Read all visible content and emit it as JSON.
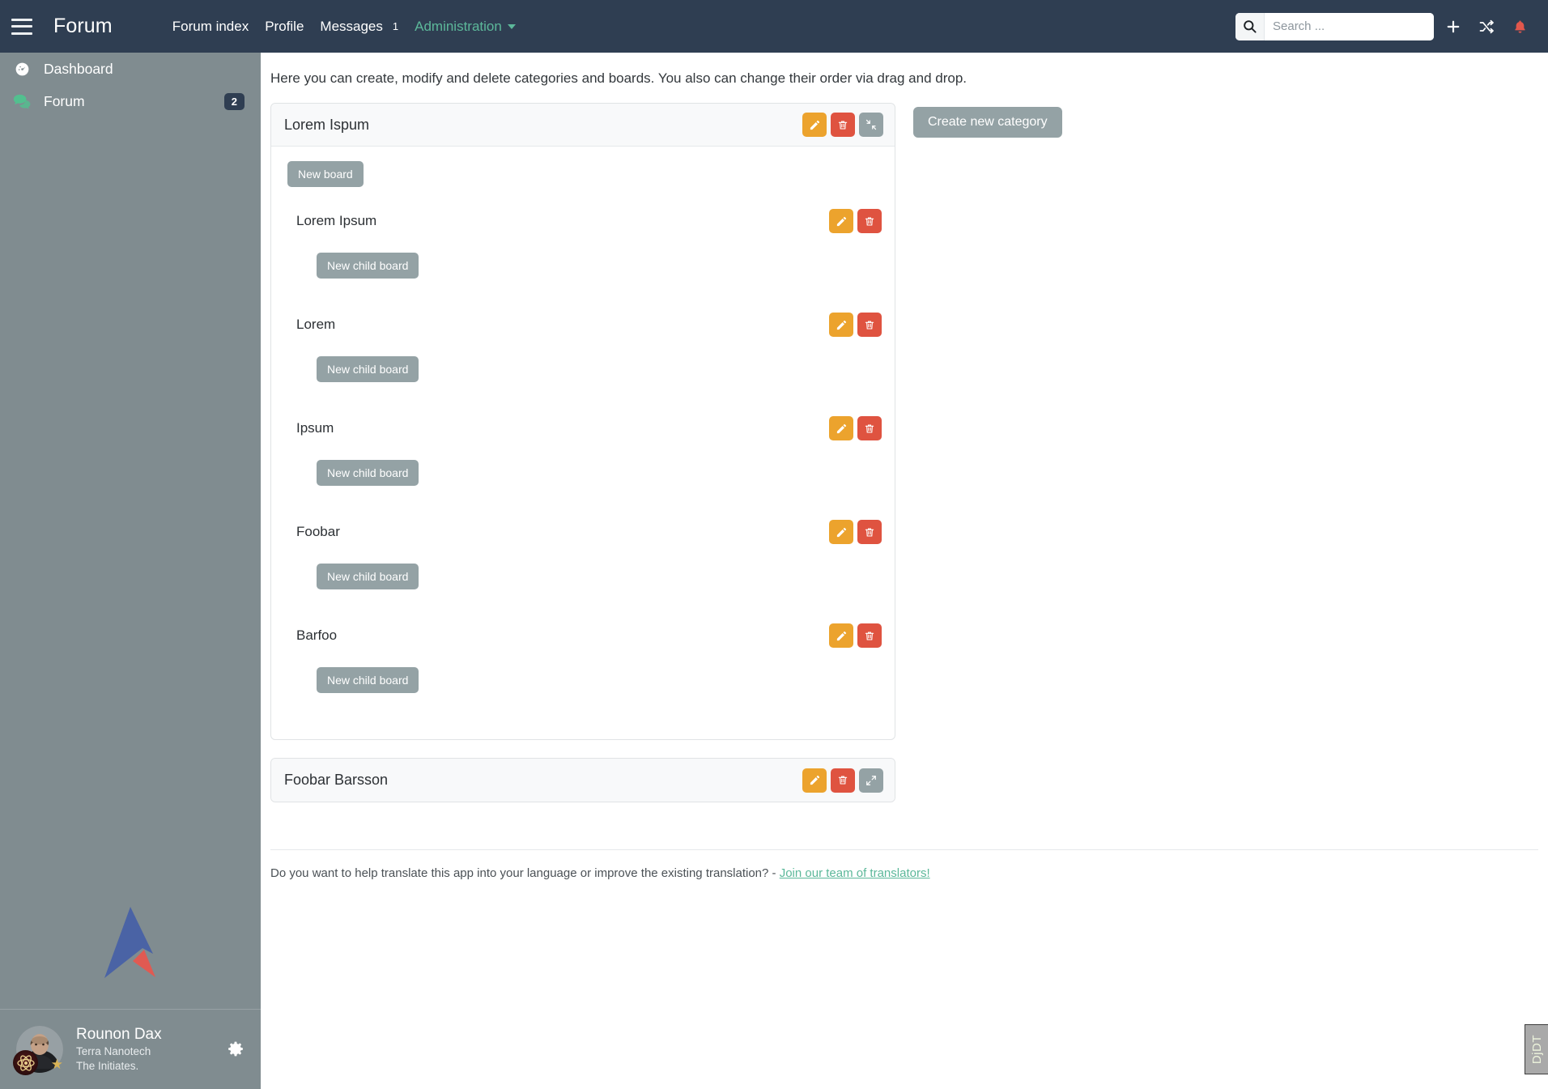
{
  "navbar": {
    "menu_icon": "hamburger-icon",
    "brand": "Forum",
    "links": [
      {
        "label": "Forum index",
        "name": "forum-index"
      },
      {
        "label": "Profile",
        "name": "profile"
      },
      {
        "label": "Messages",
        "name": "messages",
        "badge": "1"
      },
      {
        "label": "Administration",
        "name": "administration",
        "accent": true
      }
    ],
    "search": {
      "placeholder": "Search ...",
      "value": "",
      "icon": "search-icon"
    },
    "icons": [
      {
        "name": "plus-icon"
      },
      {
        "name": "shuffle-icon"
      },
      {
        "name": "bell-icon"
      }
    ]
  },
  "sidebar": {
    "items": [
      {
        "label": "Dashboard",
        "icon": "tachometer-icon",
        "badge": ""
      },
      {
        "label": "Forum",
        "icon": "comments-icon",
        "badge": "2"
      }
    ],
    "logo": "app-logo",
    "user": {
      "name": "Rounon Dax",
      "org": "Terra Nanotech",
      "group": "The Initiates.",
      "avatar": "user-avatar",
      "badge_icon": "atom-icon",
      "star_icon": "star-icon",
      "settings_icon": "gear-icon"
    }
  },
  "main": {
    "intro": "Here you can create, modify and delete categories and boards. You also can change their order via drag and drop.",
    "create_category_label": "Create new category",
    "new_board_label": "New board",
    "new_child_board_label": "New child board",
    "actions": {
      "edit": "pencil-icon",
      "delete": "trash-icon",
      "collapse": "compress-icon",
      "expand": "expand-icon"
    },
    "categories": [
      {
        "title": "Lorem Ispum",
        "collapsed": false,
        "boards": [
          {
            "name": "Lorem Ipsum"
          },
          {
            "name": "Lorem"
          },
          {
            "name": "Ipsum"
          },
          {
            "name": "Foobar"
          },
          {
            "name": "Barfoo"
          }
        ]
      },
      {
        "title": "Foobar Barsson",
        "collapsed": true,
        "boards": []
      }
    ]
  },
  "footer": {
    "text": "Do you want to help translate this app into your language or improve the existing translation? - ",
    "link": "Join our team of translators!"
  },
  "debug_toolbar": {
    "label": "DjDT"
  },
  "colors": {
    "navbar": "#2f3e52",
    "sidebar": "#808c90",
    "accent_green": "#5cb89a",
    "edit_orange": "#eca32d",
    "delete_red": "#df5340",
    "neutral_gray": "#94a2a5",
    "bell_red": "#e2574c"
  }
}
